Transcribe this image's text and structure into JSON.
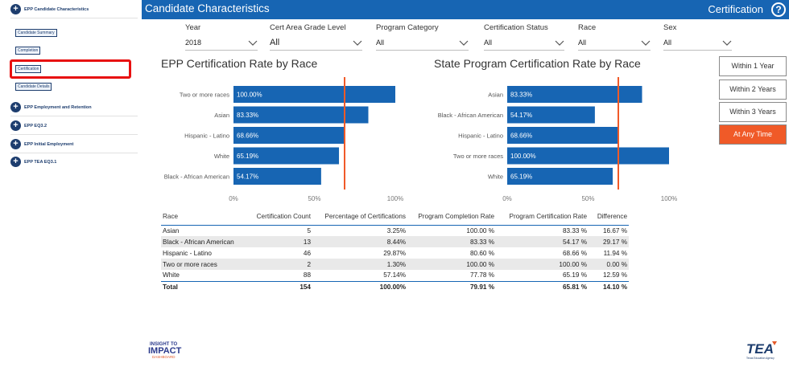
{
  "sidebar": {
    "sections": [
      {
        "label": "EPP Candidate Characteristics"
      },
      {
        "label": "EPP Employment and Retention"
      },
      {
        "label": "EPP EQ3.2"
      },
      {
        "label": "EPP Initial Employment"
      },
      {
        "label": "EPP TEA EQ3.1"
      }
    ],
    "items": [
      {
        "label": "Candidate Summary"
      },
      {
        "label": "Completion"
      },
      {
        "label": "Certification"
      },
      {
        "label": "Candidate Details"
      }
    ],
    "plus_glyph": "+"
  },
  "header": {
    "title": "Candidate Characteristics",
    "right_title": "Certification",
    "help_glyph": "?"
  },
  "filters": [
    {
      "label": "Year",
      "value": "2018"
    },
    {
      "label": "Cert Area Grade Level",
      "value": "All"
    },
    {
      "label": "Program Category",
      "value": "All"
    },
    {
      "label": "Certification Status",
      "value": "All"
    },
    {
      "label": "Race",
      "value": "All"
    },
    {
      "label": "Sex",
      "value": "All"
    }
  ],
  "time_buttons": [
    "Within 1 Year",
    "Within 2 Years",
    "Within 3 Years",
    "At Any Time"
  ],
  "colors": {
    "bar": "#1765b3",
    "reference_line": "#f05a28",
    "active_button": "#f05a28",
    "header": "#1765b3"
  },
  "chart_data": [
    {
      "type": "bar",
      "orientation": "horizontal",
      "title": "EPP Certification Rate by Race",
      "categories": [
        "Two or more races",
        "Asian",
        "Hispanic - Latino",
        "White",
        "Black - African American"
      ],
      "values": [
        100.0,
        83.33,
        68.66,
        65.19,
        54.17
      ],
      "labels": [
        "100.00%",
        "83.33%",
        "68.66%",
        "65.19%",
        "54.17%"
      ],
      "x_ticks": [
        "0%",
        "50%",
        "100%"
      ],
      "xlim": [
        0,
        100
      ],
      "reference_line": 68.66
    },
    {
      "type": "bar",
      "orientation": "horizontal",
      "title": "State Program Certification Rate by Race",
      "categories": [
        "Asian",
        "Black - African American",
        "Hispanic - Latino",
        "Two or more races",
        "White"
      ],
      "values": [
        83.33,
        54.17,
        68.66,
        100.0,
        65.19
      ],
      "labels": [
        "83.33%",
        "54.17%",
        "68.66%",
        "100.00%",
        "65.19%"
      ],
      "x_ticks": [
        "0%",
        "50%",
        "100%"
      ],
      "xlim": [
        0,
        100
      ],
      "reference_line": 68.66
    }
  ],
  "table": {
    "columns": [
      "Race",
      "Certification Count",
      "Percentage of Certifications",
      "Program Completion Rate",
      "Program Certification Rate",
      "Difference"
    ],
    "rows": [
      [
        "Asian",
        "5",
        "3.25%",
        "100.00 %",
        "83.33 %",
        "16.67 %"
      ],
      [
        "Black - African American",
        "13",
        "8.44%",
        "83.33 %",
        "54.17 %",
        "29.17 %"
      ],
      [
        "Hispanic - Latino",
        "46",
        "29.87%",
        "80.60 %",
        "68.66 %",
        "11.94 %"
      ],
      [
        "Two or more races",
        "2",
        "1.30%",
        "100.00 %",
        "100.00 %",
        "0.00 %"
      ],
      [
        "White",
        "88",
        "57.14%",
        "77.78 %",
        "65.19 %",
        "12.59 %"
      ]
    ],
    "total": [
      "Total",
      "154",
      "100.00%",
      "79.91 %",
      "65.81 %",
      "14.10 %"
    ]
  },
  "logos": {
    "impact": {
      "line1": "INSIGHT TO",
      "line2": "IMPACT",
      "line3": "DASHBOARD"
    },
    "tea": {
      "name": "TEA",
      "sub": "Texas Education Agency"
    }
  }
}
